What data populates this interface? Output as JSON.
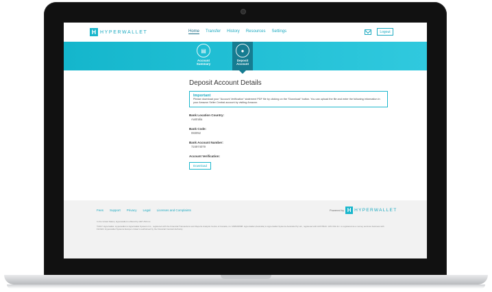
{
  "header": {
    "brand": "HYPERWALLET",
    "nav": [
      "Home",
      "Transfer",
      "History",
      "Resources",
      "Settings"
    ],
    "logout_label": "Logout"
  },
  "banner": {
    "tabs": [
      {
        "label": "Account Summary",
        "icon": "document-icon"
      },
      {
        "label": "Deposit Account",
        "icon": "bank-icon"
      }
    ]
  },
  "main": {
    "title": "Deposit Account Details",
    "notice_heading": "Important",
    "notice_text": "Please download your \"Account Verification\" statement PDF file by clicking on the \"Download\" button. You can upload the file and enter the following information in your Amazon Seller Central account by visiting Amazon.",
    "fields": [
      {
        "label": "Bank Location Country:",
        "value": "Australia"
      },
      {
        "label": "Bank Code:",
        "value": "083052"
      },
      {
        "label": "Bank Account Number:",
        "value": "724974079"
      }
    ],
    "verification_label": "Account Verification:",
    "download_label": "Download"
  },
  "footer": {
    "links": [
      "Fees",
      "Support",
      "Privacy",
      "Legal",
      "Licenses and Complaints"
    ],
    "powered_label": "Powered by",
    "powered_brand": "HYPERWALLET",
    "small_1": "In the United States, Hyperwallet is offered by HW USA Inc.",
    "small_2": "©2017 Hyperwallet. Hyperwallet is Hyperwallet Systems Inc., registered with the Financial Transactions and Reports Analysis Centre of Canada, no. M08403588. Hyperwallet (Australia) is Hyperwallet Systems Australia Pty Ltd., registered with AUSTRAC. HW USA Inc. is registered as a money services business with FinCEN. Hyperwallet Systems Europe Limited is authorised by the Financial Conduct Authority."
  },
  "colors": {
    "accent": "#19b6cc",
    "active_tab": "#167c91",
    "footer_bg": "#f2f2f2"
  }
}
